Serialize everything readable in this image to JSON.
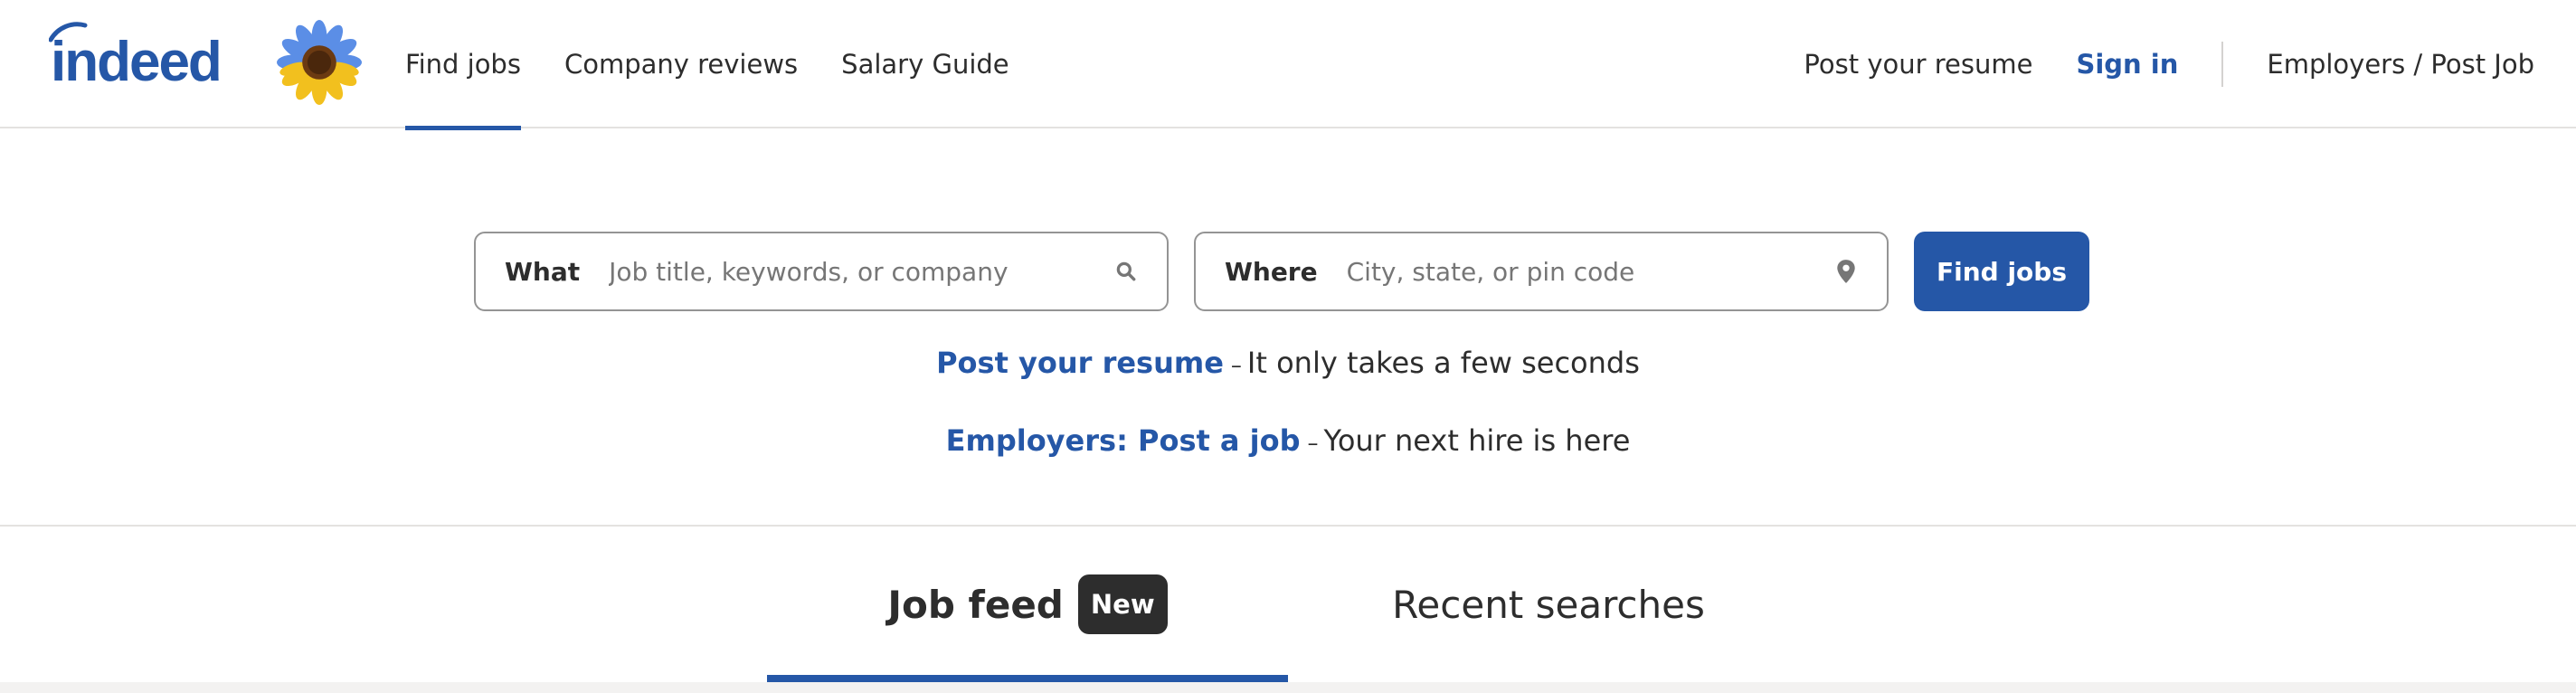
{
  "header": {
    "logo_text": "indeed",
    "nav": [
      {
        "label": "Find jobs",
        "active": true
      },
      {
        "label": "Company reviews",
        "active": false
      },
      {
        "label": "Salary Guide",
        "active": false
      }
    ],
    "post_resume_label": "Post your resume",
    "sign_in_label": "Sign in",
    "employers_label": "Employers / Post Job"
  },
  "search": {
    "what_label": "What",
    "what_placeholder": "Job title, keywords, or company",
    "what_value": "",
    "where_label": "Where",
    "where_placeholder": "City, state, or pin code",
    "where_value": "",
    "button_label": "Find jobs"
  },
  "promos": [
    {
      "link": "Post your resume",
      "dash": "–",
      "text": "It only takes a few seconds"
    },
    {
      "link": "Employers: Post a job",
      "dash": "–",
      "text": "Your next hire is here"
    }
  ],
  "tabs": [
    {
      "label": "Job feed",
      "badge": "New",
      "active": true
    },
    {
      "label": "Recent searches",
      "active": false
    }
  ],
  "colors": {
    "brand_blue": "#2557a7",
    "text": "#2d2d2d",
    "badge_bg": "#2d2d2d"
  },
  "icons": {
    "what_field": "search-icon",
    "where_field": "location-pin-icon",
    "decoration": "sunflower-icon"
  }
}
